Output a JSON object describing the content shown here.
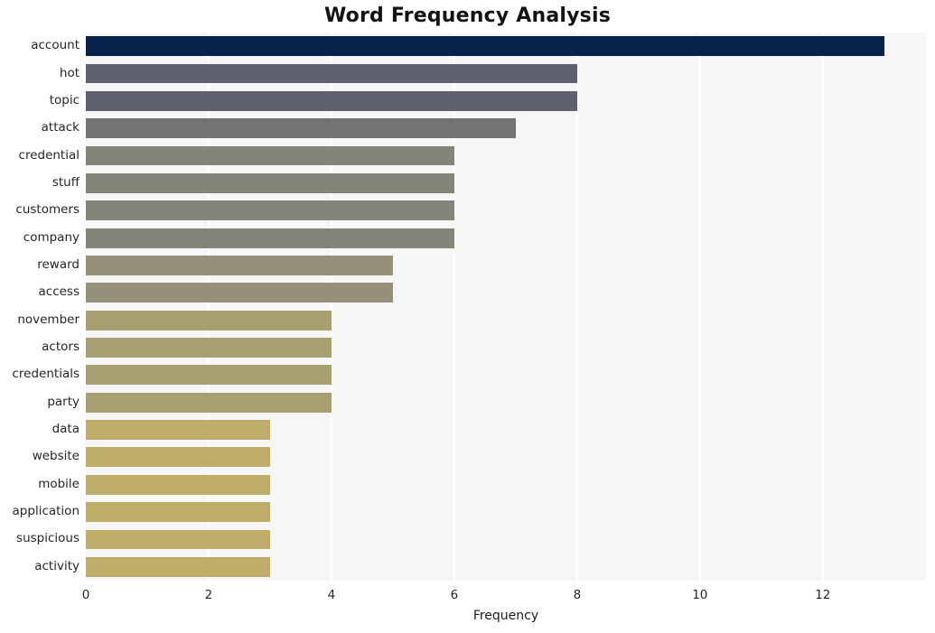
{
  "chart_data": {
    "type": "bar",
    "orientation": "horizontal",
    "title": "Word Frequency Analysis",
    "xlabel": "Frequency",
    "ylabel": "",
    "categories": [
      "account",
      "hot",
      "topic",
      "attack",
      "credential",
      "stuff",
      "customers",
      "company",
      "reward",
      "access",
      "november",
      "actors",
      "credentials",
      "party",
      "data",
      "website",
      "mobile",
      "application",
      "suspicious",
      "activity"
    ],
    "values": [
      13,
      8,
      8,
      7,
      6,
      6,
      6,
      6,
      5,
      5,
      4,
      4,
      4,
      4,
      3,
      3,
      3,
      3,
      3,
      3
    ],
    "bar_colors": [
      "#06224b",
      "#5f6170",
      "#5f6170",
      "#727373",
      "#858478",
      "#858478",
      "#858478",
      "#858478",
      "#95907a",
      "#95907a",
      "#a89f71",
      "#a89f71",
      "#a89f71",
      "#a89f71",
      "#bdad68",
      "#bdad68",
      "#bdad68",
      "#bdad68",
      "#bdad68",
      "#bdad68"
    ],
    "xticks": [
      0,
      2,
      4,
      6,
      8,
      10,
      12
    ],
    "xtick_labels": [
      "0",
      "2",
      "4",
      "6",
      "8",
      "10",
      "12"
    ],
    "xlim": [
      0,
      13.68
    ],
    "grid": true,
    "grid_axis": "x",
    "legend": false,
    "plot_background": "#f6f6f7",
    "figure_background": "#ffffff",
    "gridline_color": "#ffffff"
  }
}
